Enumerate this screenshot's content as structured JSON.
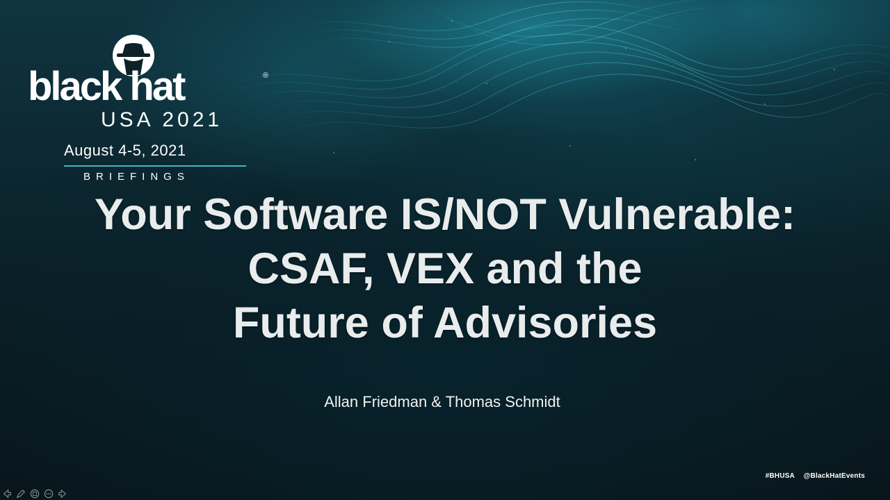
{
  "logo": {
    "brand": "black hat",
    "registered_mark": "®",
    "edition": "USA 2021",
    "dates": "August 4-5, 2021",
    "track": "BRIEFINGS"
  },
  "title_lines": [
    "Your Software IS/NOT Vulnerable:",
    "CSAF, VEX and the",
    "Future of Advisories"
  ],
  "authors": "Allan Friedman & Thomas Schmidt",
  "social": {
    "hashtag": "#BHUSA",
    "handle": "@BlackHatEvents"
  },
  "player_controls": [
    "prev-icon",
    "pen-icon",
    "slides-icon",
    "menu-icon",
    "next-icon"
  ],
  "colors": {
    "accent": "#45b5c8",
    "background": "#0b1a20",
    "title": "#e9ecec"
  }
}
